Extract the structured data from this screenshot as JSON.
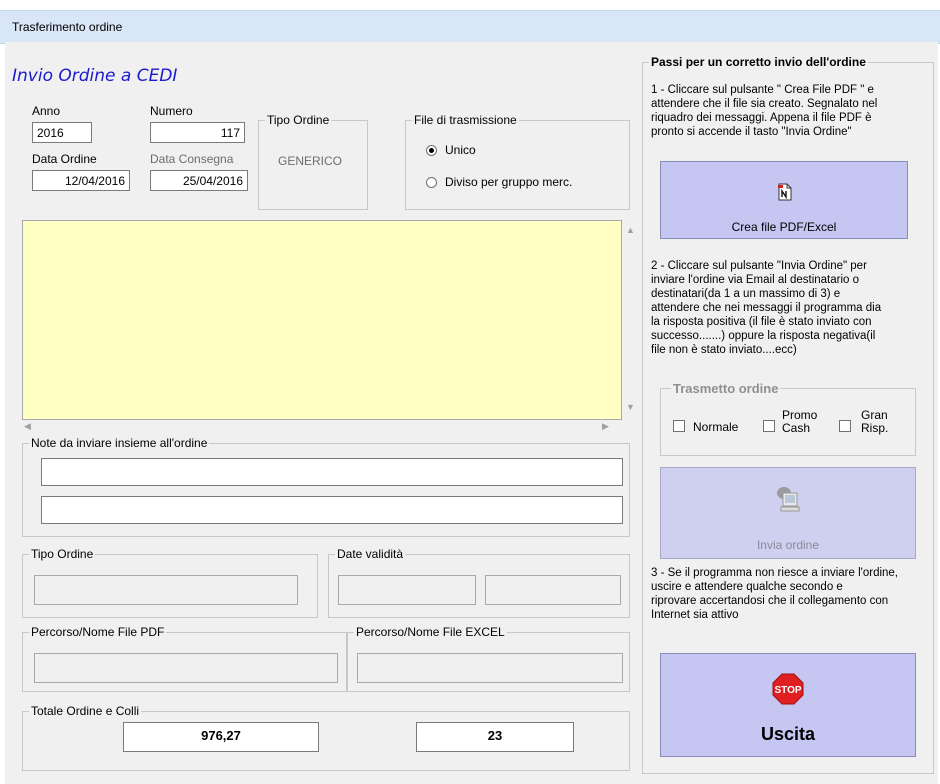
{
  "window": {
    "title": "Trasferimento ordine"
  },
  "header": {
    "title": "Invio Ordine a CEDI"
  },
  "order": {
    "anno_label": "Anno",
    "anno_value": "2016",
    "numero_label": "Numero",
    "numero_value": "117",
    "data_ordine_label": "Data Ordine",
    "data_ordine_value": "12/04/2016",
    "data_consegna_label": "Data Consegna",
    "data_consegna_value": "25/04/2016"
  },
  "tipo_ordine": {
    "legend": "Tipo Ordine",
    "value": "GENERICO"
  },
  "file_trasmissione": {
    "legend": "File di trasmissione",
    "options": [
      "Unico",
      "Diviso per gruppo merc."
    ],
    "selected": "Unico"
  },
  "note": {
    "legend": "Note da inviare insieme all'ordine",
    "line1": "",
    "line2": ""
  },
  "details": {
    "tipo_ordine_legend": "Tipo Ordine",
    "date_validita_legend": "Date validità"
  },
  "paths": {
    "pdf_legend": "Percorso/Nome File PDF",
    "excel_legend": "Percorso/Nome File EXCEL"
  },
  "totals": {
    "legend": "Totale Ordine e Colli",
    "totale": "976,27",
    "colli": "23"
  },
  "steps": {
    "legend": "Passi  per un corretto invio dell'ordine",
    "step1_lines": [
      "1 - Cliccare sul pulsante  \" Crea File PDF \" e",
      "attendere che il file sia creato. Segnalato nel",
      "riquadro dei messaggi. Appena il file PDF è",
      "pronto si accende il tasto \"Invia Ordine\""
    ],
    "step2_lines": [
      "2 - Cliccare sul pulsante  \"Invia Ordine\" per",
      "inviare l'ordine via Email al destinatario o",
      "destinatari(da 1 a un massimo di 3) e",
      "attendere che nei messaggi il programma dia",
      "la risposta positiva (il file è stato inviato con",
      "successo.......) oppure la risposta negativa(il",
      "file non è stato inviato....ecc)"
    ],
    "step3_lines": [
      "3 - Se il programma non riesce a inviare l'ordine,",
      "uscire e  attendere qualche secondo e",
      "riprovare accertandosi che il collegamento con",
      "Internet sia  attivo"
    ]
  },
  "buttons": {
    "crea_pdf": "Crea file PDF/Excel",
    "invia": "Invia ordine",
    "uscita": "Uscita",
    "stop_text": "STOP"
  },
  "trasmetto": {
    "legend": "Trasmetto ordine",
    "normale": "Normale",
    "promo_lines": [
      "Promo",
      "Cash"
    ],
    "gran_lines": [
      "Gran",
      "Risp."
    ]
  },
  "icons": {
    "pdf": "pdf-file-icon",
    "send": "send-computer-icon",
    "stop": "stop-sign-icon"
  },
  "colors": {
    "title_blue": "#1a1acc",
    "note_yellow": "#ffffc4",
    "button_lavender": "#c6c6f2",
    "stop_red": "#e02020"
  }
}
